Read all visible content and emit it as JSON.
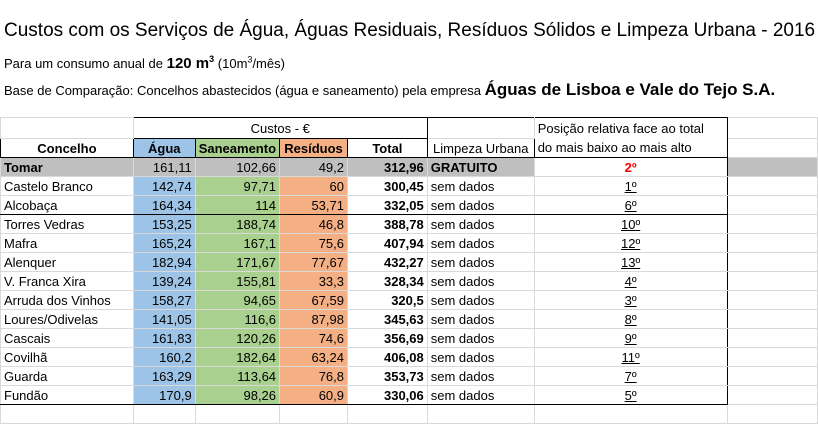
{
  "title": "Custos com os Serviços de Água, Águas Residuais, Resíduos Sólidos e Limpeza Urbana - 2016",
  "consumo": {
    "prefix": "Para um consumo anual de",
    "value": "120 m",
    "sup": "3",
    "paren_open": "(10m",
    "paren_sup": "3",
    "paren_close": "/mês)"
  },
  "comparacao": {
    "prefix": "Base de Comparação: Concelhos abastecidos (água e saneamento) pela empresa",
    "company": "Águas de Lisboa e Vale do Tejo S.A."
  },
  "headers": {
    "custos": "Custos - €",
    "posicao_line1": "Posição relativa face ao total",
    "posicao_line2": "do mais baixo ao mais alto",
    "concelho": "Concelho",
    "agua": "Água",
    "saneamento": "Saneamento",
    "residuos": "Resíduos",
    "total": "Total",
    "limpeza": "Limpeza Urbana"
  },
  "rows": [
    {
      "concelho": "Tomar",
      "agua": "161,11",
      "saneamento": "102,66",
      "residuos": "49,2",
      "total": "312,96",
      "limpeza": "GRATUITO",
      "posicao": "2º"
    },
    {
      "concelho": "Castelo Branco",
      "agua": "142,74",
      "saneamento": "97,71",
      "residuos": "60",
      "total": "300,45",
      "limpeza": "sem dados",
      "posicao": "1º"
    },
    {
      "concelho": "Alcobaça",
      "agua": "164,34",
      "saneamento": "114",
      "residuos": "53,71",
      "total": "332,05",
      "limpeza": "sem dados",
      "posicao": "6º"
    },
    {
      "concelho": "Torres Vedras",
      "agua": "153,25",
      "saneamento": "188,74",
      "residuos": "46,8",
      "total": "388,78",
      "limpeza": "sem dados",
      "posicao": "10º"
    },
    {
      "concelho": "Mafra",
      "agua": "165,24",
      "saneamento": "167,1",
      "residuos": "75,6",
      "total": "407,94",
      "limpeza": "sem dados",
      "posicao": "12º"
    },
    {
      "concelho": "Alenquer",
      "agua": "182,94",
      "saneamento": "171,67",
      "residuos": "77,67",
      "total": "432,27",
      "limpeza": "sem dados",
      "posicao": "13º"
    },
    {
      "concelho": "V. Franca Xira",
      "agua": "139,24",
      "saneamento": "155,81",
      "residuos": "33,3",
      "total": "328,34",
      "limpeza": "sem dados",
      "posicao": "4º"
    },
    {
      "concelho": "Arruda dos Vinhos",
      "agua": "158,27",
      "saneamento": "94,65",
      "residuos": "67,59",
      "total": "320,5",
      "limpeza": "sem dados",
      "posicao": "3º"
    },
    {
      "concelho": "Loures/Odivelas",
      "agua": "141,05",
      "saneamento": "116,6",
      "residuos": "87,98",
      "total": "345,63",
      "limpeza": "sem dados",
      "posicao": "8º"
    },
    {
      "concelho": "Cascais",
      "agua": "161,83",
      "saneamento": "120,26",
      "residuos": "74,6",
      "total": "356,69",
      "limpeza": "sem dados",
      "posicao": "9º"
    },
    {
      "concelho": "Covilhã",
      "agua": "160,2",
      "saneamento": "182,64",
      "residuos": "63,24",
      "total": "406,08",
      "limpeza": "sem dados",
      "posicao": "11º"
    },
    {
      "concelho": "Guarda",
      "agua": "163,29",
      "saneamento": "113,64",
      "residuos": "76,8",
      "total": "353,73",
      "limpeza": "sem dados",
      "posicao": "7º"
    },
    {
      "concelho": "Fundão",
      "agua": "170,9",
      "saneamento": "98,26",
      "residuos": "60,9",
      "total": "330,06",
      "limpeza": "sem dados",
      "posicao": "5º"
    }
  ]
}
